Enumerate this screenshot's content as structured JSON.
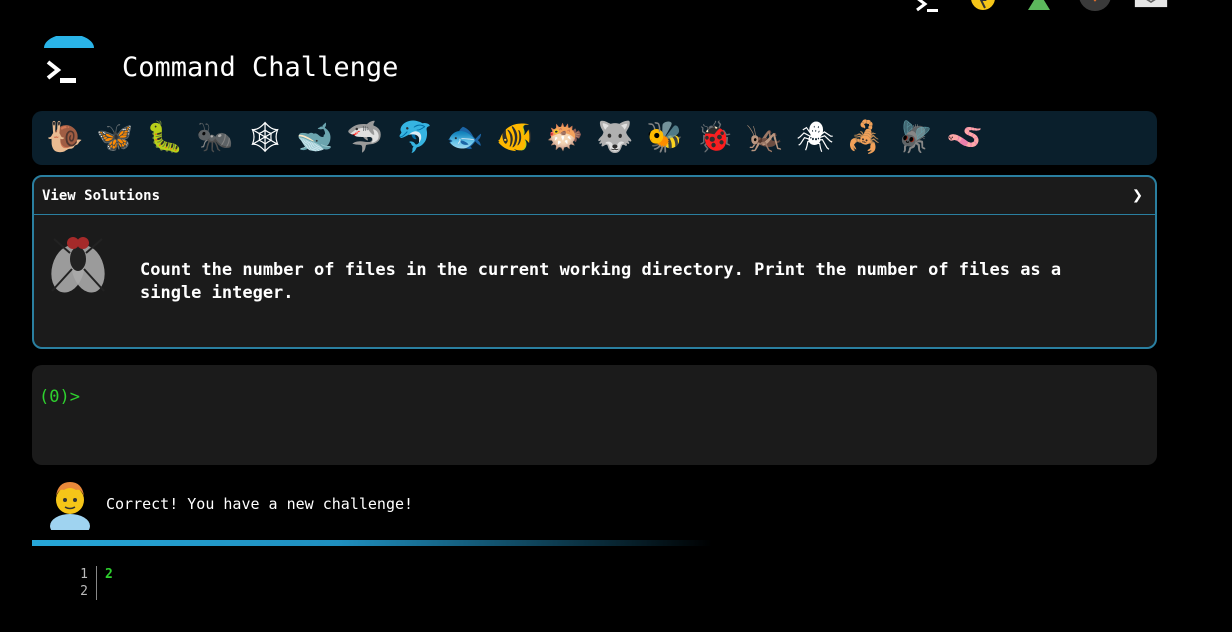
{
  "header": {
    "title": "Command Challenge"
  },
  "top_icons": [
    "prompt-icon",
    "lightbulb-icon",
    "tree-icon",
    "fox-icon",
    "mail-icon"
  ],
  "critters": [
    {
      "name": "snail-icon",
      "glyph": "🐌"
    },
    {
      "name": "butterfly-icon",
      "glyph": "🦋"
    },
    {
      "name": "caterpillar-icon",
      "glyph": "🐛"
    },
    {
      "name": "ant-icon",
      "glyph": "🐜"
    },
    {
      "name": "spider-web-icon",
      "glyph": "🕸"
    },
    {
      "name": "whale-icon",
      "glyph": "🐋"
    },
    {
      "name": "shark-icon",
      "glyph": "🦈"
    },
    {
      "name": "dolphin-icon",
      "glyph": "🐬"
    },
    {
      "name": "fish-icon",
      "glyph": "🐟"
    },
    {
      "name": "tropical-fish-icon",
      "glyph": "🐠"
    },
    {
      "name": "blowfish-icon",
      "glyph": "🐡"
    },
    {
      "name": "wolf-icon",
      "glyph": "🐺"
    },
    {
      "name": "bee-icon",
      "glyph": "🐝"
    },
    {
      "name": "ladybug-icon",
      "glyph": "🐞"
    },
    {
      "name": "cricket-icon",
      "glyph": "🦗"
    },
    {
      "name": "spider-icon",
      "glyph": "🕷"
    },
    {
      "name": "scorpion-icon",
      "glyph": "🦂"
    },
    {
      "name": "fly-icon",
      "glyph": "🪰"
    },
    {
      "name": "worm-icon",
      "glyph": "🪱"
    }
  ],
  "challenge": {
    "view_solutions_label": "View Solutions",
    "expand_glyph": "❯",
    "description": "Count the number of files in the current working directory. Print the number of files as a single integer."
  },
  "terminal": {
    "prompt": "(0)>"
  },
  "feedback": {
    "message": "Correct! You have a new challenge!"
  },
  "output": {
    "lines": [
      {
        "number": "1",
        "value": "2"
      },
      {
        "number": "2",
        "value": ""
      }
    ]
  },
  "colors": {
    "accent": "#2a7fa0",
    "prompt_green": "#2ed12e",
    "panel_bg": "#1b1b1b",
    "critter_bar_bg": "#0a1f2c",
    "progress": "#27a7d8"
  }
}
